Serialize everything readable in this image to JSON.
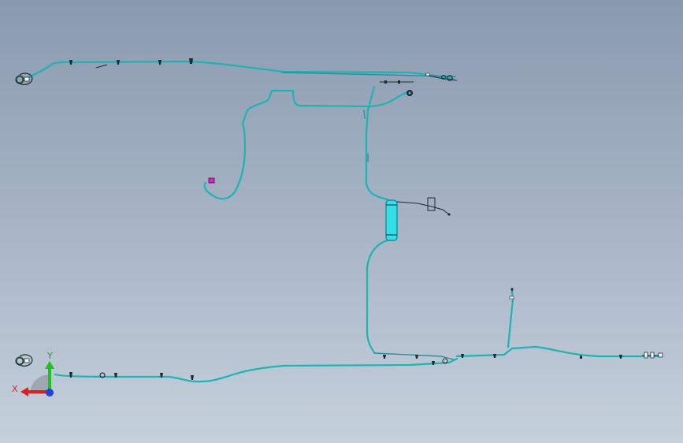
{
  "viewport": {
    "background_top": "#8a9aaf",
    "background_bottom": "#c6d0dc",
    "tube_color": "#1fb3b3",
    "marker_color": "#e020c0"
  },
  "triad": {
    "x_label": "X",
    "y_label": "Y",
    "x_color": "#e02020",
    "y_color": "#20c020",
    "z_color": "#2040e0"
  }
}
